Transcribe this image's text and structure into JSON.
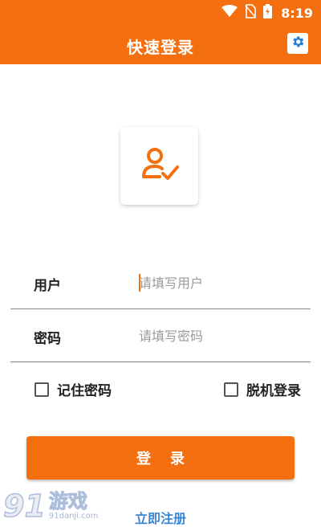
{
  "status_bar": {
    "time": "8:19",
    "icons": [
      "wifi-icon",
      "no-sim-icon",
      "battery-charging-icon"
    ]
  },
  "app_bar": {
    "title": "快速登录",
    "settings_icon": "gear-icon"
  },
  "avatar": {
    "icon": "user-check-icon"
  },
  "form": {
    "username": {
      "label": "用户",
      "placeholder": "请填写用户",
      "value": ""
    },
    "password": {
      "label": "密码",
      "placeholder": "请填写密码",
      "value": ""
    }
  },
  "options": {
    "remember_password": {
      "label": "记住密码",
      "checked": false
    },
    "offline_login": {
      "label": "脱机登录",
      "checked": false
    }
  },
  "login_button": {
    "label": "登录"
  },
  "register_link": {
    "label": "立即注册"
  },
  "watermark": {
    "logo": "91",
    "name": "游戏",
    "site": "91danji.com"
  },
  "colors": {
    "accent": "#f36f0f",
    "link": "#3a86d6"
  }
}
